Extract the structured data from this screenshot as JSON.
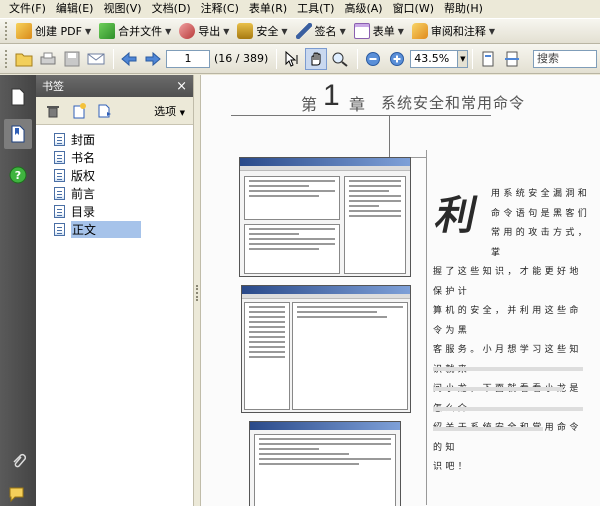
{
  "menu": [
    "文件(F)",
    "编辑(E)",
    "视图(V)",
    "文档(D)",
    "注释(C)",
    "表单(R)",
    "工具(T)",
    "高级(A)",
    "窗口(W)",
    "帮助(H)"
  ],
  "toolbar1": {
    "create_pdf": "创建 PDF",
    "combine": "合并文件",
    "export": "导出",
    "security": "安全",
    "sign": "签名",
    "forms": "表单",
    "review": "审阅和注释"
  },
  "toolbar2": {
    "page_number": "1",
    "page_count": "(16 / 389)",
    "zoom": "43.5%",
    "search_placeholder": "搜索"
  },
  "panel": {
    "title": "书签",
    "options_label": "选项",
    "close": "×",
    "bookmarks": [
      {
        "label": "封面"
      },
      {
        "label": "书名"
      },
      {
        "label": "版权"
      },
      {
        "label": "前言"
      },
      {
        "label": "目录"
      },
      {
        "label": "正文",
        "selected": true
      }
    ]
  },
  "page": {
    "chapter_prefix": "第",
    "chapter_number": "1",
    "chapter_suffix": "章",
    "chapter_title": "系统安全和常用命令",
    "drop_cap": "利",
    "intro_lines": [
      "用系统安全漏洞和",
      "命令语句是黑客们",
      "常用的攻击方式，掌",
      "握了这些知识，才能更好地保护计",
      "算机的安全，并利用这些命令为黑",
      "客服务。小月想学习这些知识就来",
      "问小龙，下面就看看小龙是怎么介",
      "绍关于系统安全和常用命令的知",
      "识吧！"
    ]
  }
}
